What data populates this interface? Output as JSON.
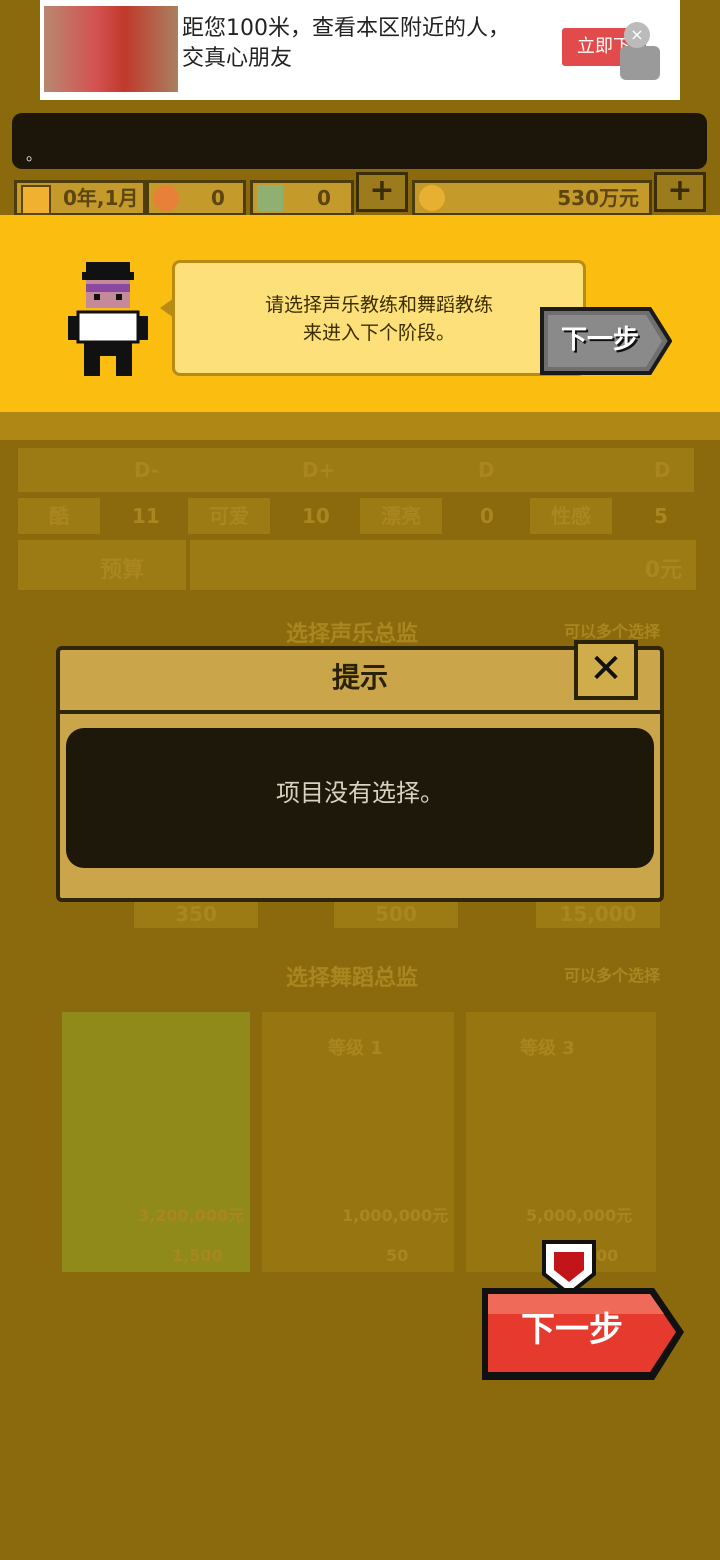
{
  "ad": {
    "text": "距您100米，查看本区附近的人，交真心朋友",
    "button": "立即下",
    "close": "×"
  },
  "message_bar": {
    "text": "。"
  },
  "stats": {
    "date": "0年,1月",
    "stat1": "0",
    "stat2": "0",
    "money": "530万元",
    "plus": "+"
  },
  "tutorial": {
    "bubble_line1": "请选择声乐教练和舞蹈教练",
    "bubble_line2": "来进入下个阶段。",
    "next_label": "下一步"
  },
  "attributes": {
    "grades": [
      "D-",
      "D+",
      "D",
      "D"
    ],
    "traits": [
      {
        "label": "酷",
        "value": "11"
      },
      {
        "label": "可爱",
        "value": "10"
      },
      {
        "label": "漂亮",
        "value": "0"
      },
      {
        "label": "性感",
        "value": "5"
      }
    ],
    "budget_label": "预算",
    "budget_value": "0元"
  },
  "vocal": {
    "title": "选择声乐总监",
    "hint": "可以多个选择",
    "stats": [
      "350",
      "500",
      "15,000"
    ]
  },
  "dance": {
    "title": "选择舞蹈总监",
    "hint": "可以多个选择",
    "cards": [
      {
        "level": "",
        "price": "3,200,000元",
        "stat": "1,500"
      },
      {
        "level": "等级 1",
        "price": "1,000,000元",
        "stat": "50"
      },
      {
        "level": "等级 3",
        "price": "5,000,000元",
        "stat": "00"
      }
    ]
  },
  "dialog": {
    "title": "提示",
    "close": "✕",
    "message": "项目没有选择。"
  },
  "next_button": {
    "label": "下一步"
  },
  "colors": {
    "band": "#fbbd0f",
    "dim": "#8a6a0c",
    "red_button": "#e63a2e"
  }
}
